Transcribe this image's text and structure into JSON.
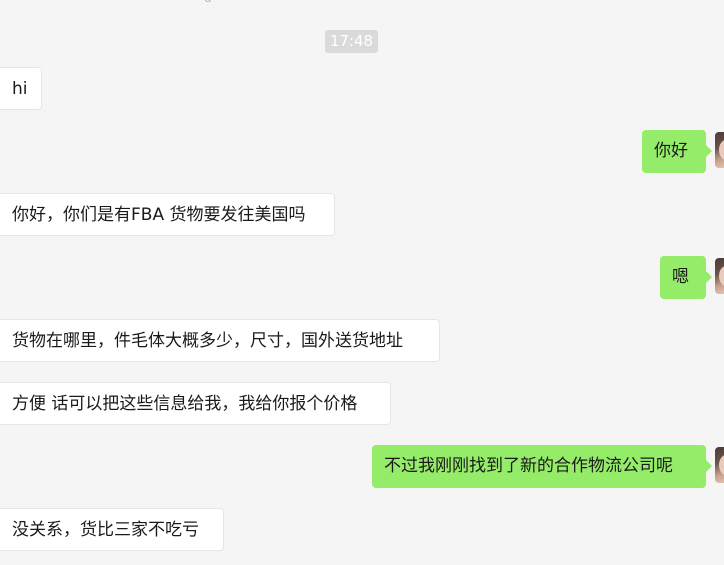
{
  "header": {
    "top_partial": "g"
  },
  "chat": {
    "timestamp": "17:48",
    "messages": [
      {
        "side": "left",
        "text": "hi"
      },
      {
        "side": "right",
        "text": "你好"
      },
      {
        "side": "left",
        "text": "你好，你们是有FBA 货物要发往美国吗"
      },
      {
        "side": "right",
        "text": "嗯"
      },
      {
        "side": "left",
        "text": "货物在哪里，件毛体大概多少，尺寸，国外送货地址"
      },
      {
        "side": "left",
        "text": "方便 话可以把这些信息给我，我给你报个价格"
      },
      {
        "side": "right",
        "text": "不过我刚刚找到了新的合作物流公司呢"
      },
      {
        "side": "left",
        "text": "没关系，货比三家不吃亏"
      }
    ]
  },
  "colors": {
    "background": "#f5f5f5",
    "sent_bubble": "#95ec69",
    "received_bubble": "#ffffff",
    "timestamp_bg": "#dadada"
  }
}
